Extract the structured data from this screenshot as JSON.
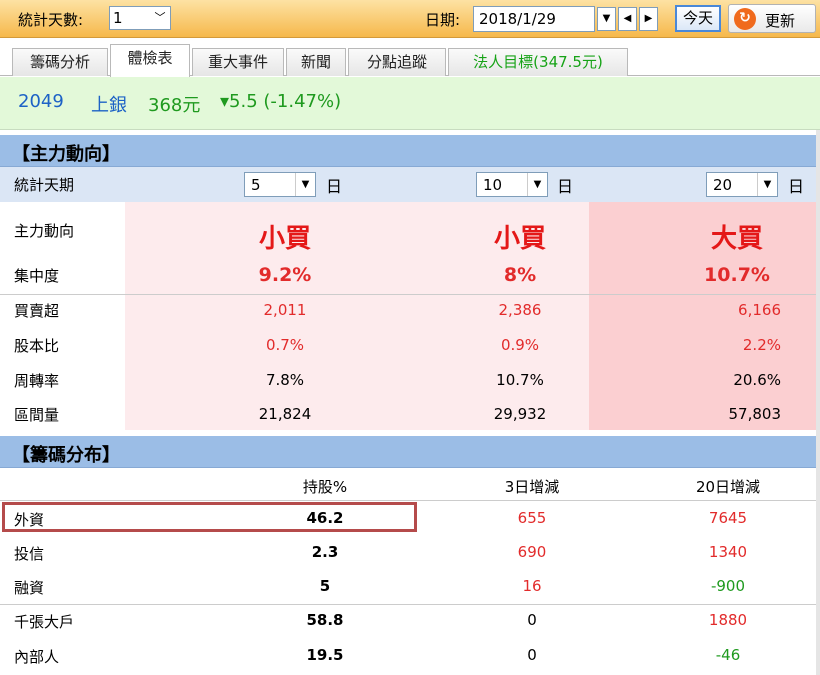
{
  "toolbar": {
    "stat_days_label": "統計天數:",
    "stat_days_value": "1",
    "date_label": "日期:",
    "date_value": "2018/1/29",
    "today_label": "今天",
    "refresh_label": "更新"
  },
  "tabs": [
    {
      "label": "籌碼分析"
    },
    {
      "label": "體檢表"
    },
    {
      "label": "重大事件"
    },
    {
      "label": "新聞"
    },
    {
      "label": "分點追蹤"
    },
    {
      "label": "法人目標(347.5元)"
    }
  ],
  "stock": {
    "code": "2049",
    "name": "上銀",
    "price": "368元",
    "change": "▾5.5 (-1.47%)"
  },
  "main_force": {
    "title": "【主力動向】",
    "period_label": "統計天期",
    "unit": "日",
    "periods": [
      "5",
      "10",
      "20"
    ],
    "rows": [
      {
        "label": "主力動向",
        "values": [
          "小買",
          "小買",
          "大買"
        ]
      },
      {
        "label": "集中度",
        "values": [
          "9.2%",
          "8%",
          "10.7%"
        ]
      },
      {
        "label": "買賣超",
        "values": [
          "2,011",
          "2,386",
          "6,166"
        ]
      },
      {
        "label": "股本比",
        "values": [
          "0.7%",
          "0.9%",
          "2.2%"
        ]
      },
      {
        "label": "周轉率",
        "values": [
          "7.8%",
          "10.7%",
          "20.6%"
        ]
      },
      {
        "label": "區間量",
        "values": [
          "21,824",
          "29,932",
          "57,803"
        ]
      }
    ]
  },
  "distribution": {
    "title": "【籌碼分布】",
    "headers": [
      "持股%",
      "3日增減",
      "20日增減"
    ],
    "rows": [
      {
        "label": "外資",
        "hold": "46.2",
        "d3": "655",
        "d20": "7645"
      },
      {
        "label": "投信",
        "hold": "2.3",
        "d3": "690",
        "d20": "1340"
      },
      {
        "label": "融資",
        "hold": "5",
        "d3": "16",
        "d20": "-900"
      },
      {
        "label": "千張大戶",
        "hold": "58.8",
        "d3": "0",
        "d20": "1880"
      },
      {
        "label": "內部人",
        "hold": "19.5",
        "d3": "0",
        "d20": "-46"
      }
    ]
  },
  "colors": {
    "up": "#e22b2b",
    "down": "#1f9a1f",
    "header_bg": "#9bbde6",
    "stock_bg": "#e3f9d9"
  }
}
